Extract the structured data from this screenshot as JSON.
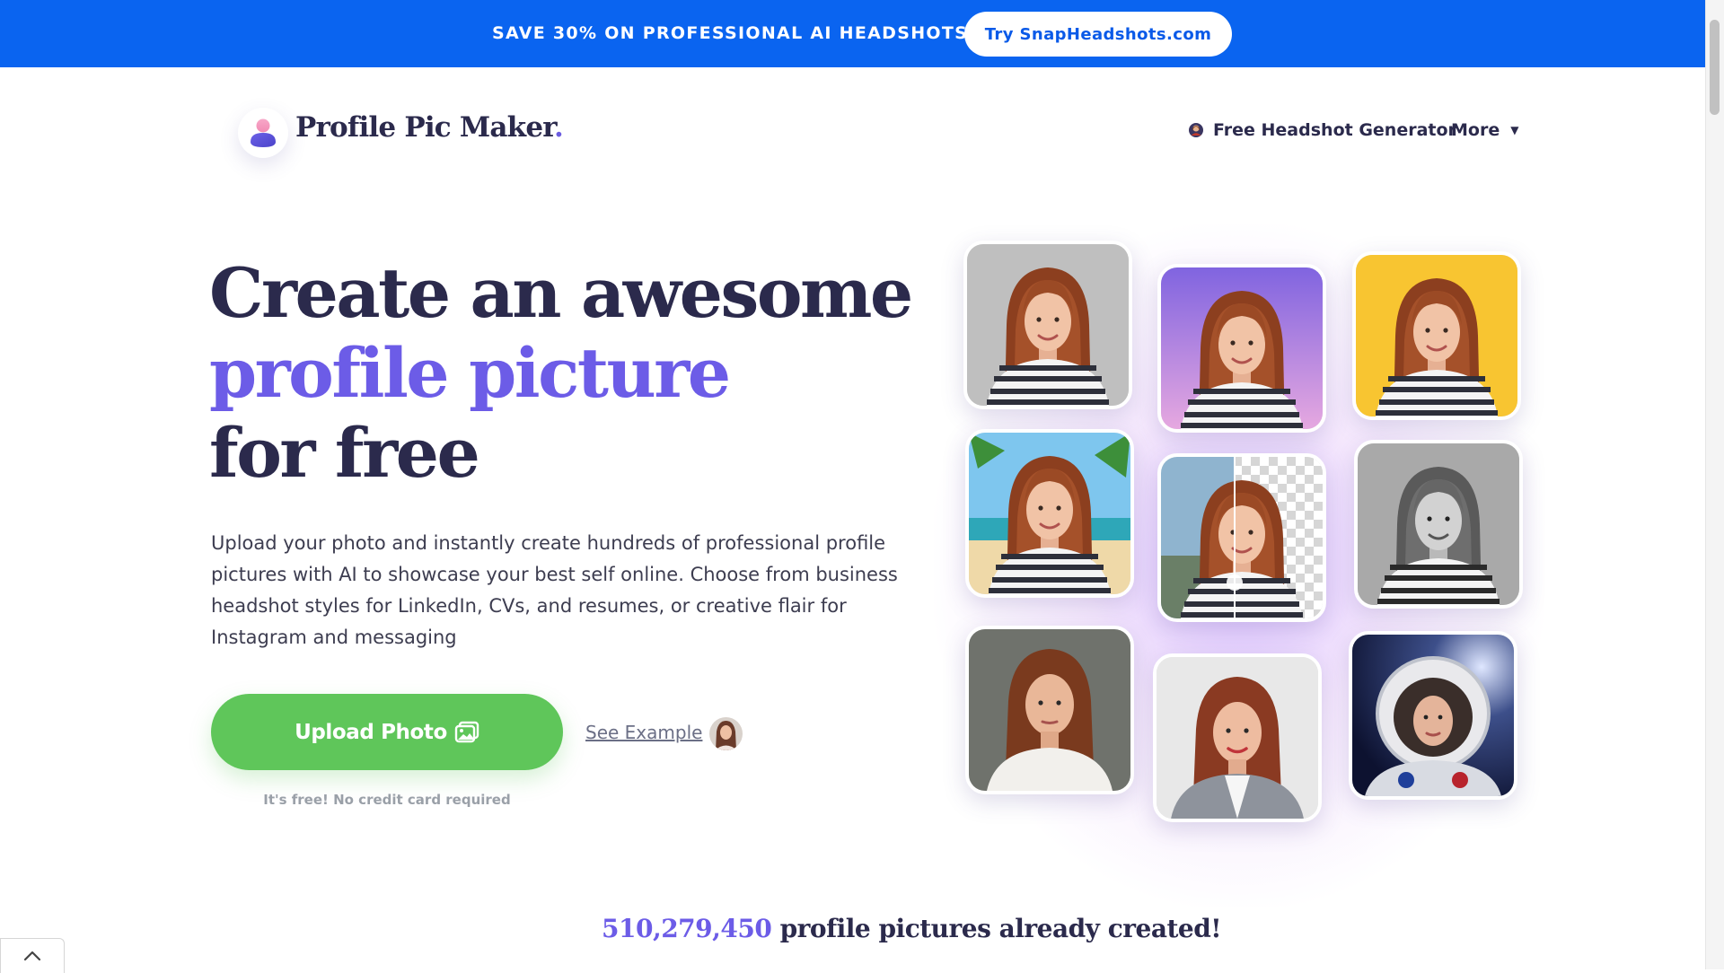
{
  "promo": {
    "text": "SAVE 30% ON PROFESSIONAL AI HEADSHOTS",
    "button_label": "Try SnapHeadshots.com"
  },
  "header": {
    "logo_text": "Profile Pic Maker",
    "logo_dot": ".",
    "nav": {
      "headshot_label": "Free Headshot Generator",
      "more_label": "More"
    }
  },
  "hero": {
    "title_line1": "Create an awesome",
    "title_line2": "profile picture",
    "title_line3": "for free",
    "description": "Upload your photo and instantly create hundreds of professional profile pictures with AI to showcase your best self online. Choose from business headshot styles for LinkedIn, CVs, and resumes, or creative flair for Instagram and messaging",
    "upload_label": "Upload Photo",
    "free_note": "It's free! No credit card required",
    "see_example_label": "See Example"
  },
  "counter": {
    "number": "510,279,450",
    "text": "profile pictures already created!"
  },
  "colors": {
    "promo_bg": "#0a64f0",
    "accent": "#6c5ce7",
    "upload_green": "#5fc65a",
    "title_dark": "#2b2a4c"
  }
}
